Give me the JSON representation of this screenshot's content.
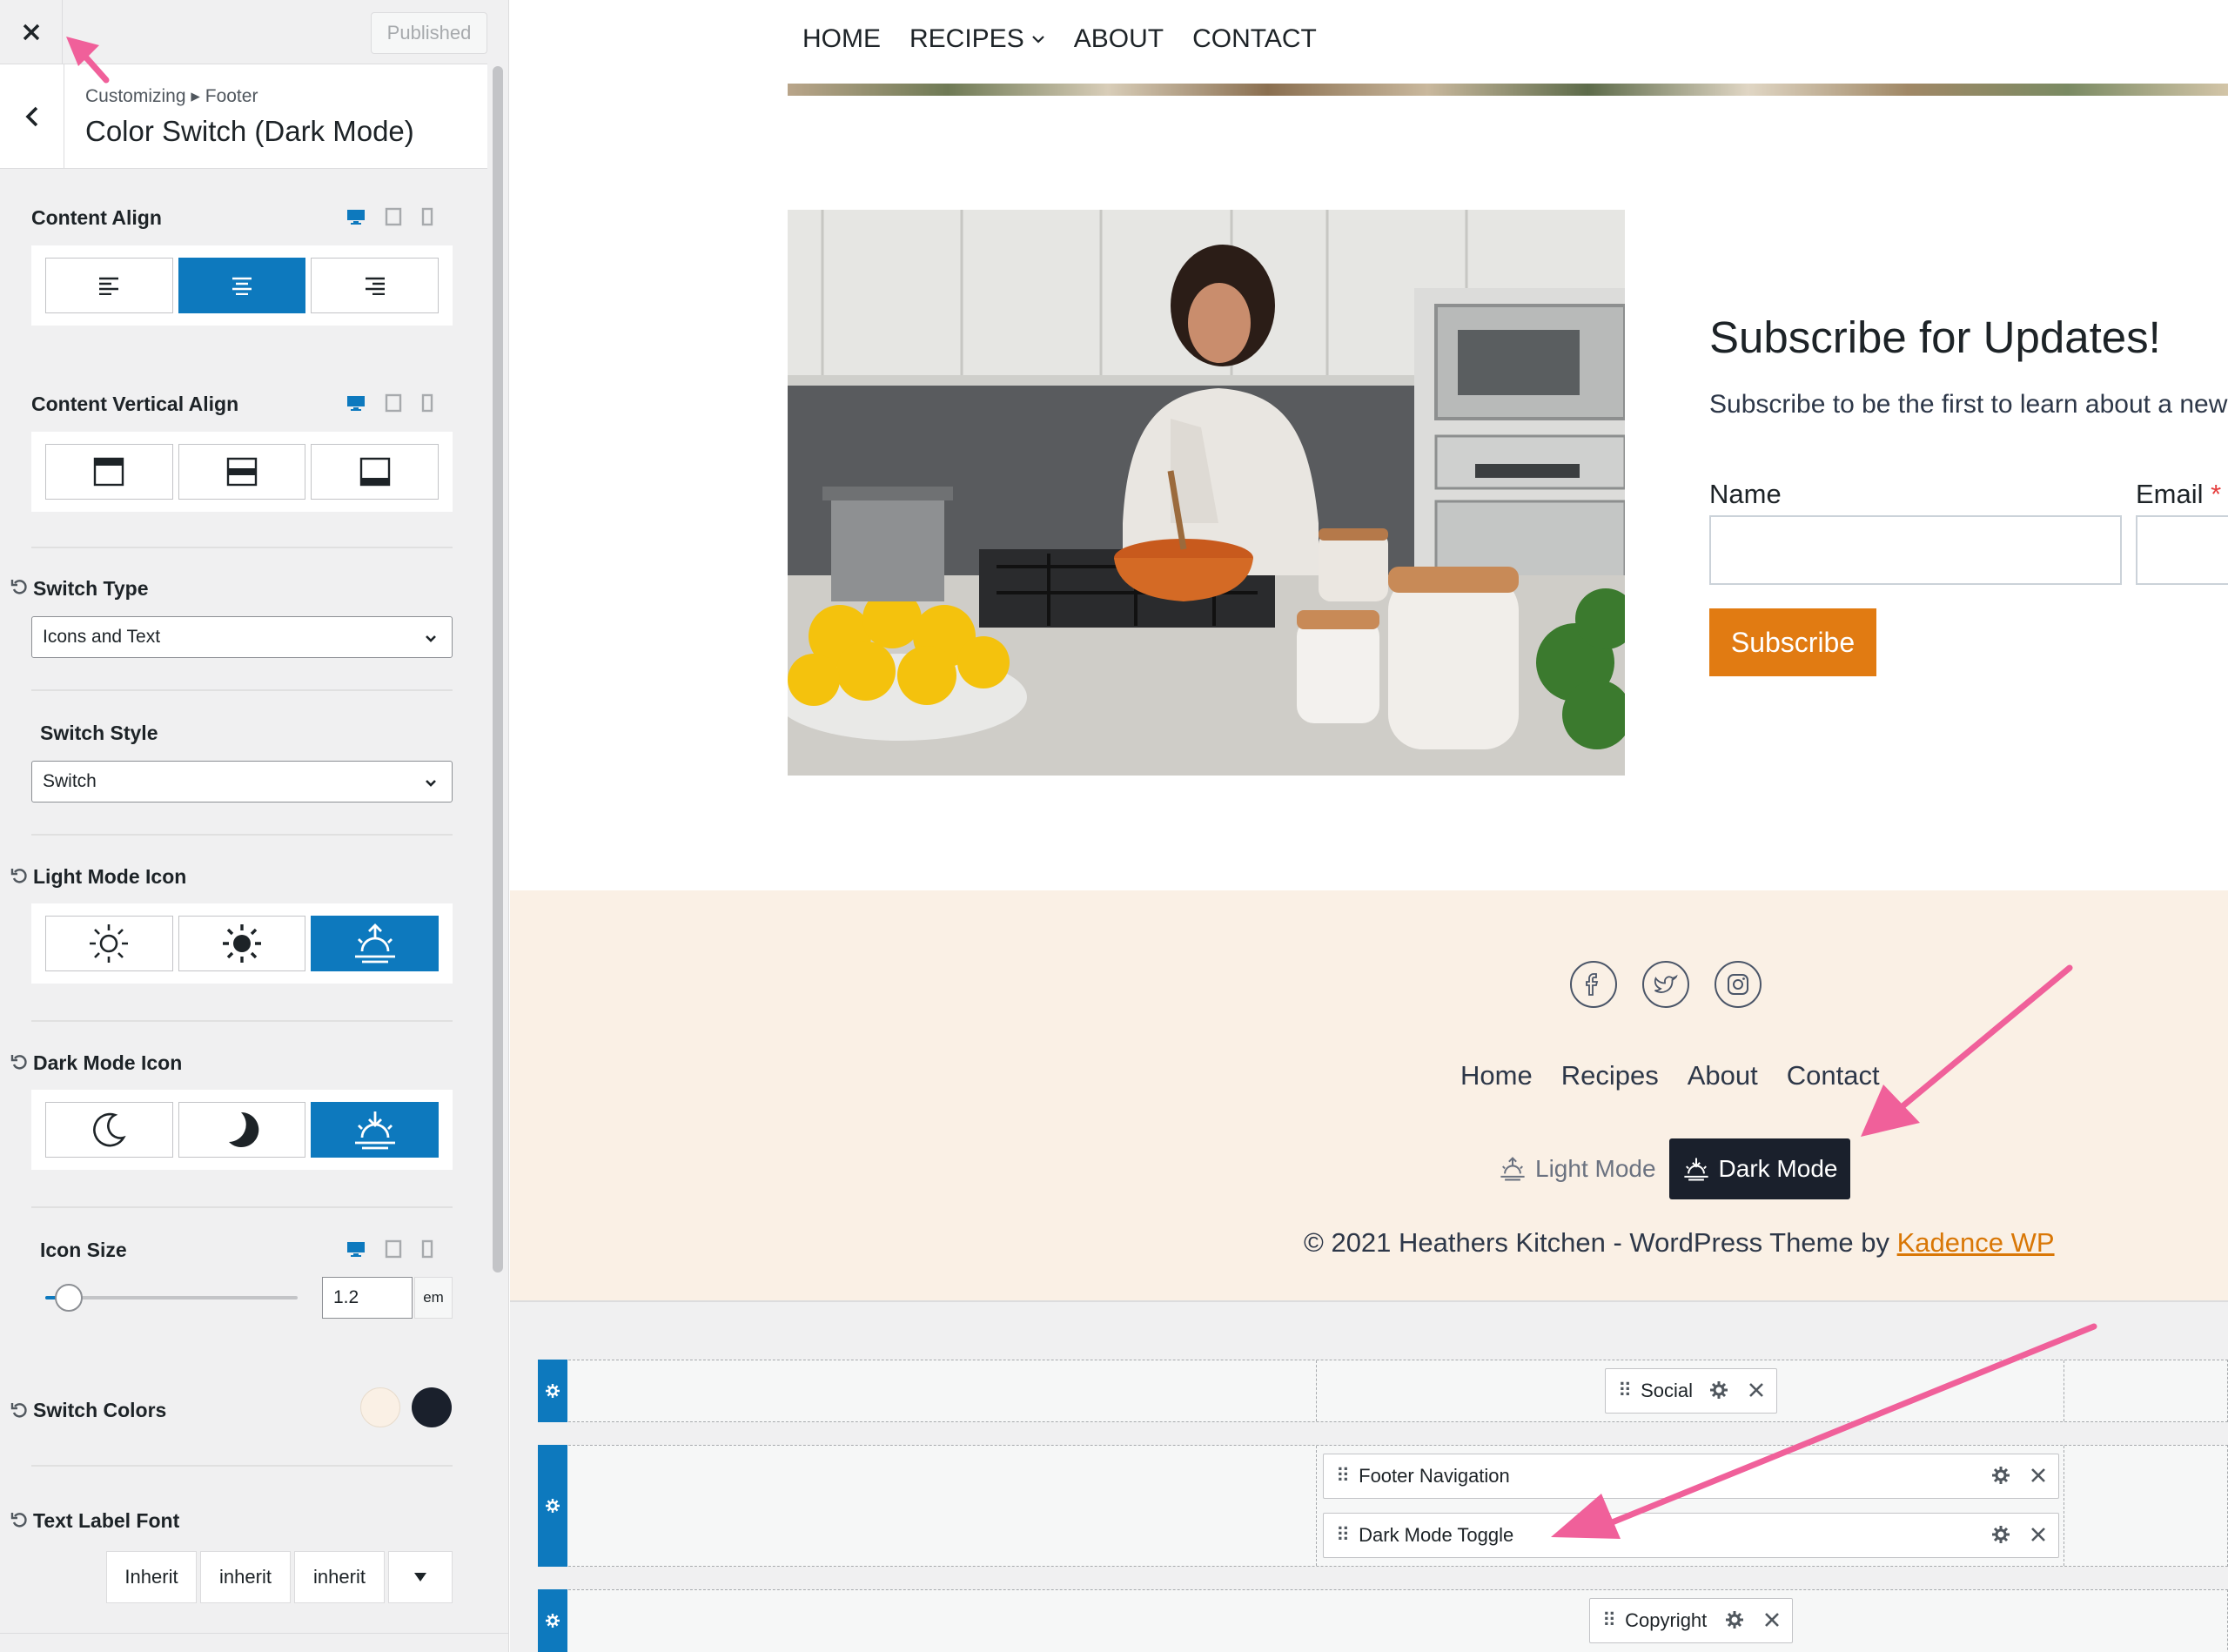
{
  "sidebar": {
    "published_label": "Published",
    "breadcrumb": "Customizing ▸ Footer",
    "title": "Color Switch (Dark Mode)",
    "content_align": {
      "label": "Content Align",
      "selected_index": 1
    },
    "content_vertical_align": {
      "label": "Content Vertical Align"
    },
    "switch_type": {
      "label": "Switch Type",
      "value": "Icons and Text"
    },
    "switch_style": {
      "label": "Switch Style",
      "value": "Switch"
    },
    "light_mode_icon": {
      "label": "Light Mode Icon",
      "selected_index": 2
    },
    "dark_mode_icon": {
      "label": "Dark Mode Icon",
      "selected_index": 2
    },
    "icon_size": {
      "label": "Icon Size",
      "value": "1.2",
      "unit": "em",
      "slider_fraction": 0.1
    },
    "switch_colors": {
      "label": "Switch Colors",
      "light": "#faf0e5",
      "dark": "#1a202c"
    },
    "text_label_font": {
      "label": "Text Label Font",
      "family": "Inherit",
      "weight": "inherit",
      "style": "inherit"
    }
  },
  "site": {
    "nav": [
      "HOME",
      "RECIPES",
      "ABOUT",
      "CONTACT"
    ],
    "subscribe": {
      "title": "Subscribe for Updates!",
      "text": "Subscribe to be the first to learn about a new",
      "name_label": "Name",
      "email_label": "Email",
      "required_mark": "*",
      "button": "Subscribe"
    },
    "footer_nav": [
      "Home",
      "Recipes",
      "About",
      "Contact"
    ],
    "light_mode_label": "Light Mode",
    "dark_mode_label": "Dark Mode",
    "copyright": "© 2021 Heathers Kitchen - WordPress Theme by ",
    "copyright_link": "Kadence WP"
  },
  "builder": {
    "items": [
      "Social",
      "Footer Navigation",
      "Dark Mode Toggle",
      "Copyright"
    ]
  },
  "colors": {
    "accent": "#0d79be",
    "orange": "#e17b12",
    "annotation": "#f0609a",
    "footer_bg": "#faf0e5"
  }
}
